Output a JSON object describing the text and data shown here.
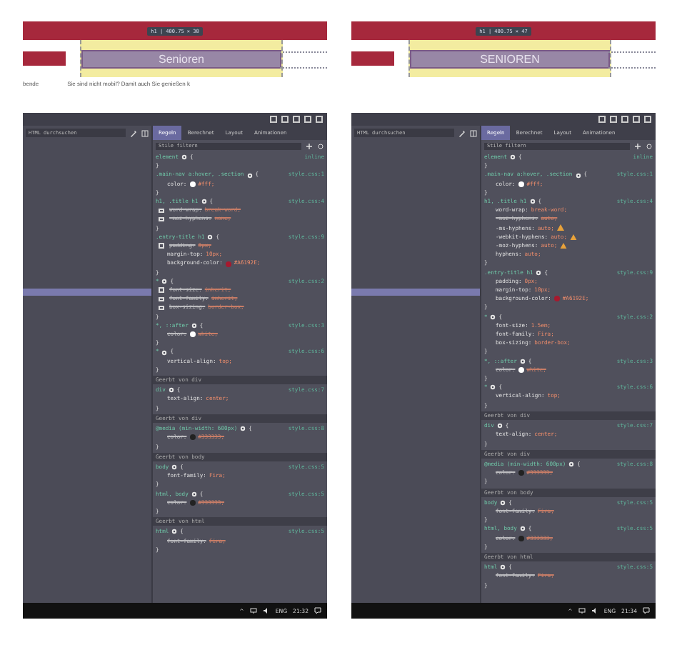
{
  "panels": [
    {
      "preview": {
        "badge": "h1 | 400.75 × 30",
        "heading": "Senioren",
        "caption_left": "bende",
        "caption": "Sie sind nicht mobil? Damit auch Sie genießen k"
      },
      "search": {
        "placeholder": "HTML durchsuchen"
      },
      "tabs": [
        {
          "label": "Regeln",
          "selected": true
        },
        {
          "label": "Berechnet",
          "selected": false
        },
        {
          "label": "Layout",
          "selected": false
        },
        {
          "label": "Animationen",
          "selected": false
        }
      ],
      "filter": {
        "placeholder": "Stile filtern"
      },
      "rules": [
        {
          "kind": "rule",
          "selector": "element",
          "open": "{",
          "close": "}",
          "source": "inline"
        },
        {
          "kind": "rule",
          "selector": ".main-nav a:hover, .section",
          "open": "{",
          "close": "}",
          "source": "style.css:1",
          "decls": [
            {
              "prop": "color:",
              "value": "#fff;",
              "color": "#ffffff",
              "disabled": false,
              "overridden": false,
              "warning": false
            }
          ]
        },
        {
          "kind": "rule",
          "selector": "h1, .title h1",
          "open": "{",
          "close": "}",
          "source": "style.css:4",
          "decls": [
            {
              "prop": "word-wrap:",
              "value": "break-word;",
              "disabled": true,
              "overridden": true,
              "warning": false
            },
            {
              "prop": "-moz-hyphens:",
              "value": "none;",
              "disabled": true,
              "overridden": true,
              "warning": false
            }
          ]
        },
        {
          "kind": "rule",
          "selector": ".entry-title h1",
          "open": "{",
          "close": "}",
          "source": "style.css:9",
          "decls": [
            {
              "prop": "padding:",
              "value": "0px;",
              "disabled": true,
              "overridden": true,
              "warning": false
            },
            {
              "prop": "margin-top:",
              "value": "10px;",
              "disabled": false,
              "overridden": false,
              "warning": false
            },
            {
              "prop": "background-color:",
              "value": "#A6192E;",
              "color": "#a6192e",
              "disabled": false,
              "overridden": false,
              "warning": false
            }
          ]
        },
        {
          "kind": "rule",
          "selector": "*",
          "open": "{",
          "close": "}",
          "source": "style.css:2",
          "decls": [
            {
              "prop": "font-size:",
              "value": "inherit;",
              "disabled": true,
              "overridden": true,
              "warning": false
            },
            {
              "prop": "font-family:",
              "value": "inherit;",
              "disabled": true,
              "overridden": true,
              "warning": false
            },
            {
              "prop": "box-sizing:",
              "value": "border-box;",
              "disabled": true,
              "overridden": true,
              "warning": false
            }
          ]
        },
        {
          "kind": "rule",
          "selector": "*, ::after",
          "open": "{",
          "close": "}",
          "source": "style.css:3",
          "decls": [
            {
              "prop": "color:",
              "value": "white;",
              "color": "#ffffff",
              "disabled": false,
              "overridden": true,
              "warning": false
            }
          ]
        },
        {
          "kind": "rule",
          "selector": "*",
          "open": "{",
          "close": "}",
          "source": "style.css:6",
          "decls": [
            {
              "prop": "vertical-align:",
              "value": "top;",
              "disabled": false,
              "overridden": false,
              "warning": false
            }
          ]
        },
        {
          "kind": "section",
          "label": "Geerbt von div"
        },
        {
          "kind": "rule",
          "selector": "div",
          "open": "{",
          "close": "}",
          "source": "style.css:7",
          "decls": [
            {
              "prop": "text-align:",
              "value": "center;",
              "disabled": false,
              "overridden": false,
              "warning": false
            }
          ]
        },
        {
          "kind": "section",
          "label": "Geerbt von div"
        },
        {
          "kind": "rule",
          "selector": "@media (min-width: 600px)",
          "open": "{",
          "close": "}",
          "source": "style.css:8",
          "decls": [
            {
              "prop": "color:",
              "value": "#333333;",
              "color": "#222222",
              "disabled": false,
              "overridden": true,
              "warning": false
            }
          ]
        },
        {
          "kind": "section",
          "label": "Geerbt von body"
        },
        {
          "kind": "rule",
          "selector": "body",
          "open": "{",
          "close": "}",
          "source": "style.css:5",
          "decls": [
            {
              "prop": "font-family:",
              "value": "Fira;",
              "disabled": false,
              "overridden": false,
              "warning": false
            }
          ]
        },
        {
          "kind": "rule",
          "selector": "html, body",
          "open": "{",
          "close": "}",
          "source": "style.css:5",
          "decls": [
            {
              "prop": "color:",
              "value": "#333333;",
              "color": "#222222",
              "disabled": false,
              "overridden": true,
              "warning": false
            }
          ]
        },
        {
          "kind": "section",
          "label": "Geerbt von html"
        },
        {
          "kind": "rule",
          "selector": "html",
          "open": "{",
          "close": "}",
          "source": "style.css:5",
          "decls": [
            {
              "prop": "font-family:",
              "value": "Fira;",
              "disabled": false,
              "overridden": true,
              "warning": false
            }
          ]
        }
      ],
      "taskbar": {
        "caret": "^",
        "language": "ENG",
        "time": "21:32"
      }
    },
    {
      "preview": {
        "badge": "h1 | 400.75 × 47",
        "heading": "SENIOREN"
      },
      "search": {
        "placeholder": "HTML durchsuchen"
      },
      "tabs": [
        {
          "label": "Regeln",
          "selected": true
        },
        {
          "label": "Berechnet",
          "selected": false
        },
        {
          "label": "Layout",
          "selected": false
        },
        {
          "label": "Animationen",
          "selected": false
        }
      ],
      "filter": {
        "placeholder": "Stile filtern"
      },
      "rules": [
        {
          "kind": "rule",
          "selector": "element",
          "open": "{",
          "close": "}",
          "source": "inline"
        },
        {
          "kind": "rule",
          "selector": ".main-nav a:hover, .section",
          "open": "{",
          "close": "}",
          "source": "style.css:1",
          "decls": [
            {
              "prop": "color:",
              "value": "#fff;",
              "color": "#ffffff",
              "disabled": false,
              "overridden": false,
              "warning": false
            }
          ]
        },
        {
          "kind": "rule",
          "selector": "h1, .title h1",
          "open": "{",
          "close": "}",
          "source": "style.css:4",
          "decls": [
            {
              "prop": "word-wrap:",
              "value": "break-word;",
              "disabled": false,
              "overridden": false,
              "warning": false
            },
            {
              "prop": "-moz-hyphens:",
              "value": "auto;",
              "disabled": false,
              "overridden": true,
              "warning": false
            },
            {
              "prop": "-ms-hyphens:",
              "value": "auto;",
              "disabled": false,
              "overridden": false,
              "warning": true
            },
            {
              "prop": "-webkit-hyphens:",
              "value": "auto;",
              "disabled": false,
              "overridden": false,
              "warning": true
            },
            {
              "prop": "-moz-hyphens:",
              "value": "auto;",
              "disabled": false,
              "overridden": false,
              "warning": true
            },
            {
              "prop": "hyphens:",
              "value": "auto;",
              "disabled": false,
              "overridden": false,
              "warning": false
            }
          ]
        },
        {
          "kind": "rule",
          "selector": ".entry-title h1",
          "open": "{",
          "close": "}",
          "source": "style.css:9",
          "decls": [
            {
              "prop": "padding:",
              "value": "0px;",
              "disabled": false,
              "overridden": false,
              "warning": false
            },
            {
              "prop": "margin-top:",
              "value": "10px;",
              "disabled": false,
              "overridden": false,
              "warning": false
            },
            {
              "prop": "background-color:",
              "value": "#A6192E;",
              "color": "#a6192e",
              "disabled": false,
              "overridden": false,
              "warning": false
            }
          ]
        },
        {
          "kind": "rule",
          "selector": "*",
          "open": "{",
          "close": "}",
          "source": "style.css:2",
          "decls": [
            {
              "prop": "font-size:",
              "value": "1.5em;",
              "disabled": false,
              "overridden": false,
              "warning": false
            },
            {
              "prop": "font-family:",
              "value": "Fira;",
              "disabled": false,
              "overridden": false,
              "warning": false
            },
            {
              "prop": "box-sizing:",
              "value": "border-box;",
              "disabled": false,
              "overridden": false,
              "warning": false
            }
          ]
        },
        {
          "kind": "rule",
          "selector": "*, ::after",
          "open": "{",
          "close": "}",
          "source": "style.css:3",
          "decls": [
            {
              "prop": "color:",
              "value": "white;",
              "color": "#ffffff",
              "disabled": false,
              "overridden": true,
              "warning": false
            }
          ]
        },
        {
          "kind": "rule",
          "selector": "*",
          "open": "{",
          "close": "}",
          "source": "style.css:6",
          "decls": [
            {
              "prop": "vertical-align:",
              "value": "top;",
              "disabled": false,
              "overridden": false,
              "warning": false
            }
          ]
        },
        {
          "kind": "section",
          "label": "Geerbt von div"
        },
        {
          "kind": "rule",
          "selector": "div",
          "open": "{",
          "close": "}",
          "source": "style.css:7",
          "decls": [
            {
              "prop": "text-align:",
              "value": "center;",
              "disabled": false,
              "overridden": false,
              "warning": false
            }
          ]
        },
        {
          "kind": "section",
          "label": "Geerbt von div"
        },
        {
          "kind": "rule",
          "selector": "@media (min-width: 600px)",
          "open": "{",
          "close": "}",
          "source": "style.css:8",
          "decls": [
            {
              "prop": "color:",
              "value": "#333333;",
              "color": "#222222",
              "disabled": false,
              "overridden": true,
              "warning": false
            }
          ]
        },
        {
          "kind": "section",
          "label": "Geerbt von body"
        },
        {
          "kind": "rule",
          "selector": "body",
          "open": "{",
          "close": "}",
          "source": "style.css:5",
          "decls": [
            {
              "prop": "font-family:",
              "value": "Fira;",
              "disabled": false,
              "overridden": true,
              "warning": false
            }
          ]
        },
        {
          "kind": "rule",
          "selector": "html, body",
          "open": "{",
          "close": "}",
          "source": "style.css:5",
          "decls": [
            {
              "prop": "color:",
              "value": "#333333;",
              "color": "#222222",
              "disabled": false,
              "overridden": true,
              "warning": false
            }
          ]
        },
        {
          "kind": "section",
          "label": "Geerbt von html"
        },
        {
          "kind": "rule",
          "selector": "html",
          "open": "{",
          "close": "}",
          "source": "style.css:5",
          "decls": [
            {
              "prop": "font-family:",
              "value": "Fira;",
              "disabled": false,
              "overridden": true,
              "warning": false
            }
          ]
        }
      ],
      "taskbar": {
        "caret": "^",
        "language": "ENG",
        "time": "21:34"
      }
    }
  ]
}
